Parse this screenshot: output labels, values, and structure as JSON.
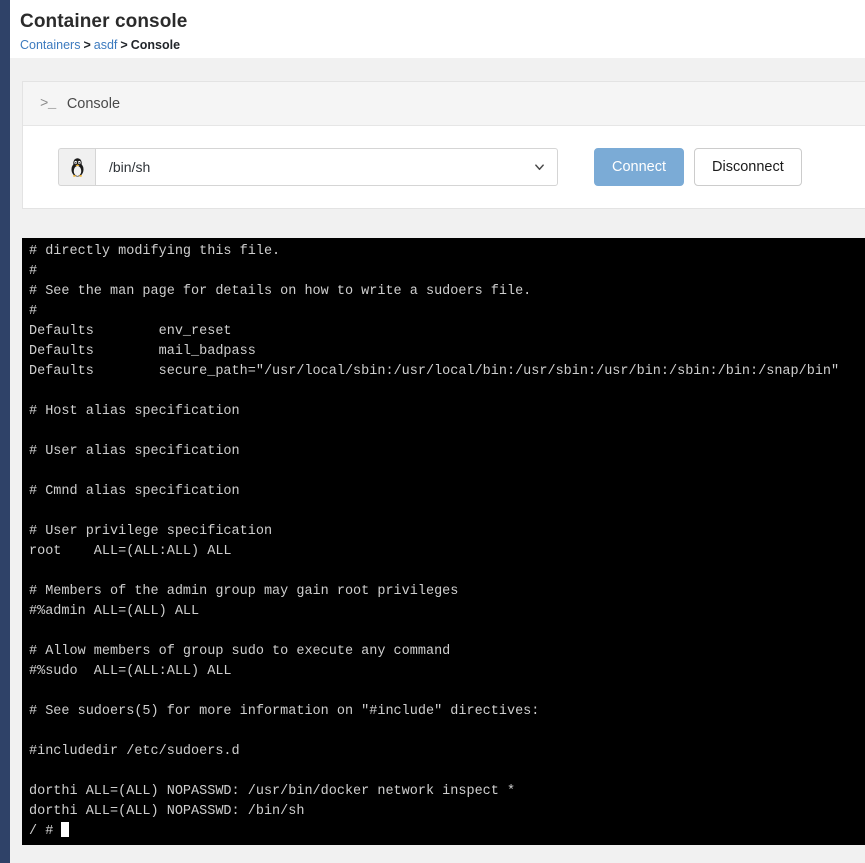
{
  "header": {
    "title": "Container console",
    "breadcrumb": {
      "items": [
        {
          "label": "Containers",
          "link": true
        },
        {
          "label": "asdf",
          "link": true
        },
        {
          "label": "Console",
          "link": false
        }
      ],
      "separator": ">"
    }
  },
  "console_card": {
    "prompt_glyph": ">_",
    "title": "Console",
    "shell_select": {
      "value": "/bin/sh",
      "icon": "tux-penguin-icon",
      "chevron": "chevron-down-icon"
    },
    "buttons": {
      "connect": "Connect",
      "disconnect": "Disconnect"
    }
  },
  "terminal": {
    "prompt": "/ # ",
    "lines": [
      "# directly modifying this file.",
      "#",
      "# See the man page for details on how to write a sudoers file.",
      "#",
      "Defaults        env_reset",
      "Defaults        mail_badpass",
      "Defaults        secure_path=\"/usr/local/sbin:/usr/local/bin:/usr/sbin:/usr/bin:/sbin:/bin:/snap/bin\"",
      "",
      "# Host alias specification",
      "",
      "# User alias specification",
      "",
      "# Cmnd alias specification",
      "",
      "# User privilege specification",
      "root    ALL=(ALL:ALL) ALL",
      "",
      "# Members of the admin group may gain root privileges",
      "#%admin ALL=(ALL) ALL",
      "",
      "# Allow members of group sudo to execute any command",
      "#%sudo  ALL=(ALL:ALL) ALL",
      "",
      "# See sudoers(5) for more information on \"#include\" directives:",
      "",
      "#includedir /etc/sudoers.d",
      "",
      "dorthi ALL=(ALL) NOPASSWD: /usr/bin/docker network inspect *",
      "dorthi ALL=(ALL) NOPASSWD: /bin/sh"
    ]
  },
  "colors": {
    "nav_rail": "#2f4268",
    "link": "#3d7bbf",
    "connect_button": "#7babd6",
    "terminal_bg": "#000000",
    "terminal_fg": "#cfcfcf",
    "page_bg": "#f1f1f1"
  }
}
